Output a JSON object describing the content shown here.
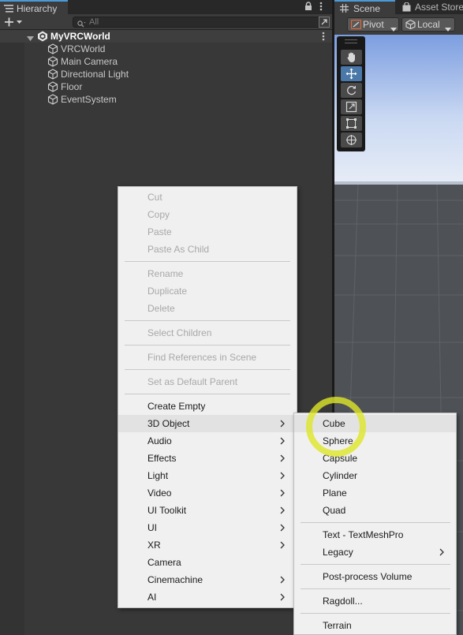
{
  "hierarchy": {
    "tab_label": "Hierarchy",
    "search_placeholder": "All",
    "scene_name": "MyVRCWorld",
    "objects": [
      "VRCWorld",
      "Main Camera",
      "Directional Light",
      "Floor",
      "EventSystem"
    ]
  },
  "scene_view": {
    "tabs": [
      "Scene",
      "Asset Store"
    ],
    "pivot_label": "Pivot",
    "local_label": "Local",
    "tools": [
      "hand-icon",
      "move-icon",
      "rotate-icon",
      "scale-icon",
      "rect-icon",
      "transform-icon"
    ],
    "active_tool": "move-icon"
  },
  "context_menu": {
    "groups": [
      [
        {
          "label": "Cut",
          "disabled": true
        },
        {
          "label": "Copy",
          "disabled": true
        },
        {
          "label": "Paste",
          "disabled": true
        },
        {
          "label": "Paste As Child",
          "disabled": true
        }
      ],
      [
        {
          "label": "Rename",
          "disabled": true
        },
        {
          "label": "Duplicate",
          "disabled": true
        },
        {
          "label": "Delete",
          "disabled": true
        }
      ],
      [
        {
          "label": "Select Children",
          "disabled": true
        }
      ],
      [
        {
          "label": "Find References in Scene",
          "disabled": true
        }
      ],
      [
        {
          "label": "Set as Default Parent",
          "disabled": true
        }
      ],
      [
        {
          "label": "Create Empty"
        },
        {
          "label": "3D Object",
          "submenu": true,
          "highlighted": true
        },
        {
          "label": "Audio",
          "submenu": true
        },
        {
          "label": "Effects",
          "submenu": true
        },
        {
          "label": "Light",
          "submenu": true
        },
        {
          "label": "Video",
          "submenu": true
        },
        {
          "label": "UI Toolkit",
          "submenu": true
        },
        {
          "label": "UI",
          "submenu": true
        },
        {
          "label": "XR",
          "submenu": true
        },
        {
          "label": "Camera"
        },
        {
          "label": "Cinemachine",
          "submenu": true
        },
        {
          "label": "AI",
          "submenu": true
        }
      ]
    ]
  },
  "submenu_3d_object": {
    "groups": [
      [
        {
          "label": "Cube",
          "highlighted": true
        },
        {
          "label": "Sphere"
        },
        {
          "label": "Capsule"
        },
        {
          "label": "Cylinder"
        },
        {
          "label": "Plane"
        },
        {
          "label": "Quad"
        }
      ],
      [
        {
          "label": "Text - TextMeshPro"
        },
        {
          "label": "Legacy",
          "submenu": true
        }
      ],
      [
        {
          "label": "Post-process Volume"
        }
      ],
      [
        {
          "label": "Ragdoll..."
        }
      ],
      [
        {
          "label": "Terrain"
        }
      ]
    ]
  },
  "colors": {
    "accent": "#4a9ad8",
    "click_highlight": "#dee628"
  }
}
